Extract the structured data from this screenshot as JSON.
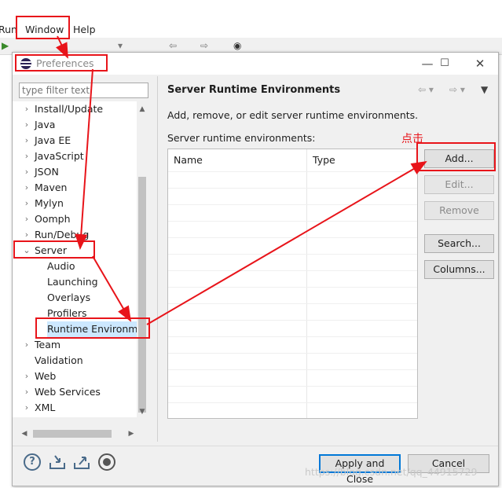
{
  "menubar": {
    "run": "Run",
    "window": "Window",
    "help": "Help"
  },
  "dialog": {
    "title": "Preferences",
    "icons": {
      "minimize": "minimize-icon",
      "maximize": "maximize-icon",
      "close": "close-icon"
    }
  },
  "filter": {
    "placeholder": "type filter text"
  },
  "tree": {
    "items": [
      {
        "label": "Install/Update",
        "state": "collapsed"
      },
      {
        "label": "Java",
        "state": "collapsed"
      },
      {
        "label": "Java EE",
        "state": "collapsed"
      },
      {
        "label": "JavaScript",
        "state": "collapsed"
      },
      {
        "label": "JSON",
        "state": "collapsed"
      },
      {
        "label": "Maven",
        "state": "collapsed"
      },
      {
        "label": "Mylyn",
        "state": "collapsed"
      },
      {
        "label": "Oomph",
        "state": "collapsed"
      },
      {
        "label": "Run/Debug",
        "state": "collapsed"
      },
      {
        "label": "Server",
        "state": "expanded"
      },
      {
        "label": "Audio",
        "state": "child"
      },
      {
        "label": "Launching",
        "state": "child"
      },
      {
        "label": "Overlays",
        "state": "child"
      },
      {
        "label": "Profilers",
        "state": "child"
      },
      {
        "label": "Runtime Environme",
        "state": "child-selected"
      },
      {
        "label": "Team",
        "state": "collapsed"
      },
      {
        "label": "Validation",
        "state": "leaf"
      },
      {
        "label": "Web",
        "state": "collapsed"
      },
      {
        "label": "Web Services",
        "state": "collapsed"
      },
      {
        "label": "XML",
        "state": "collapsed"
      }
    ]
  },
  "page": {
    "title": "Server Runtime Environments",
    "description": "Add, remove, or edit server runtime environments.",
    "list_label": "Server runtime environments:",
    "columns": [
      "Name",
      "Type"
    ]
  },
  "buttons": {
    "add": "Add...",
    "edit": "Edit...",
    "remove": "Remove",
    "search": "Search...",
    "columns": "Columns...",
    "apply_close": "Apply and Close",
    "cancel": "Cancel"
  },
  "annotation": {
    "click_label": "点击"
  },
  "watermark": "https://blog.csdn.net/qq_44915729",
  "colors": {
    "annotation_red": "#e8141a",
    "selection": "#cce8ff",
    "default_button_border": "#0078d7"
  }
}
